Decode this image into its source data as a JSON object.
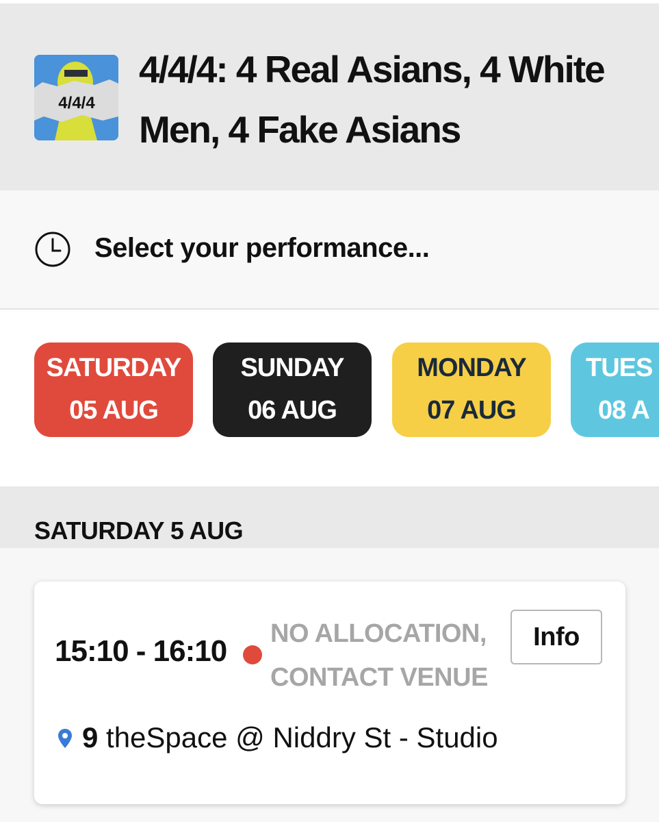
{
  "event": {
    "title": "4/4/4: 4 Real Asians, 4 White Men, 4 Fake Asians",
    "thumbnail_text": "4/4/4",
    "thumbnail_colors": {
      "background": "#4a92d9",
      "figure": "#d8de3a",
      "paper": "#dcdcdc"
    }
  },
  "performance_select": {
    "icon": "clock-icon",
    "prompt": "Select your performance..."
  },
  "dates": [
    {
      "day": "SATURDAY",
      "date": "05 AUG",
      "bg": "#e04a3c",
      "fg": "#ffffff"
    },
    {
      "day": "SUNDAY",
      "date": "06 AUG",
      "bg": "#1f1f1f",
      "fg": "#ffffff"
    },
    {
      "day": "MONDAY",
      "date": "07 AUG",
      "bg": "#f6cf47",
      "fg": "#1b2a3a"
    },
    {
      "day": "TUES",
      "date": "08 A",
      "bg": "#5ec7df",
      "fg": "#ffffff"
    }
  ],
  "section": {
    "title": "SATURDAY 5 AUG"
  },
  "performance": {
    "time": "15:10 - 16:10",
    "status_color": "#e04a3c",
    "status_line1": "NO ALLOCATION,",
    "status_line2": "CONTACT VENUE",
    "info_label": "Info",
    "venue_icon": "map-pin-icon",
    "venue_number": "9",
    "venue_name": "theSpace @ Niddry St - Studio"
  }
}
